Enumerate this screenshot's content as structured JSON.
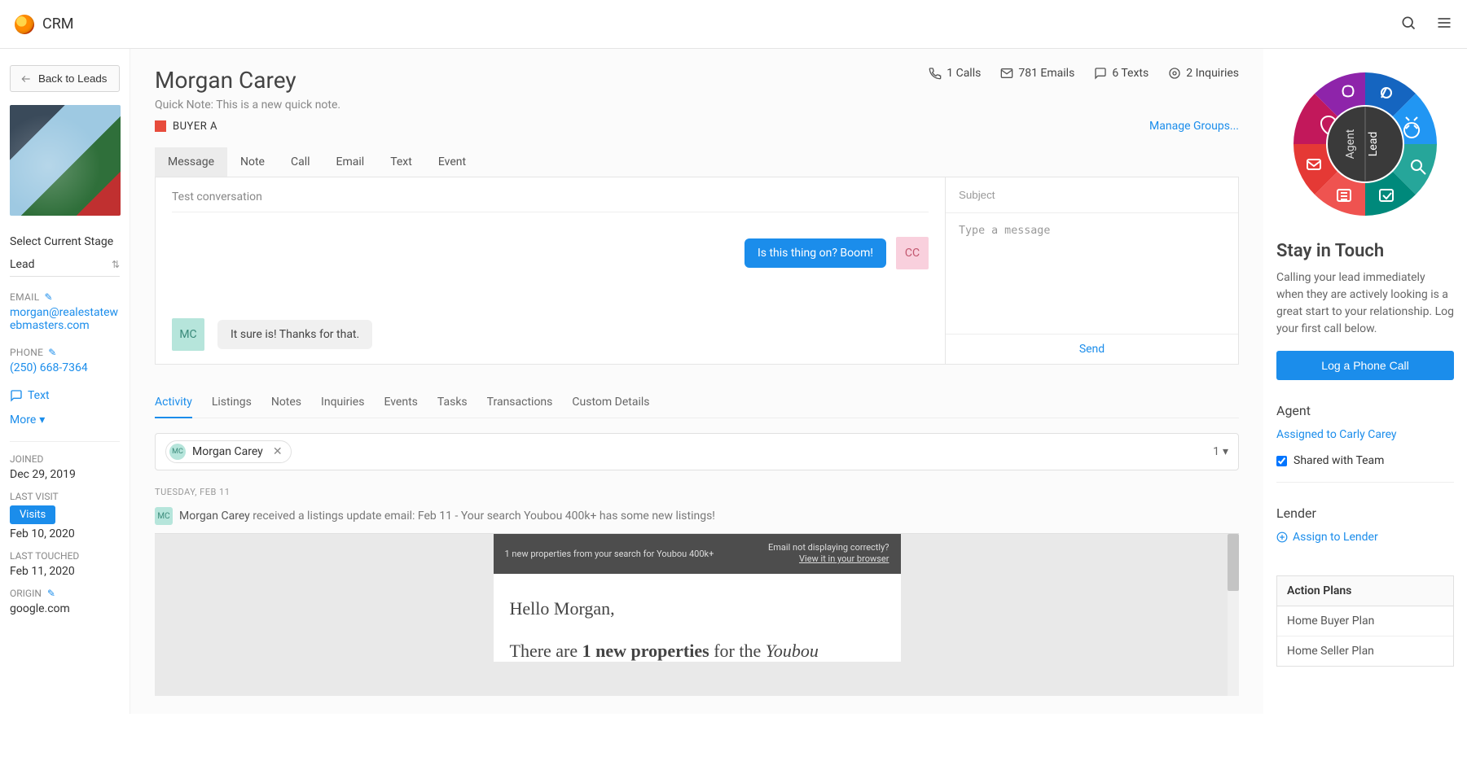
{
  "topbar": {
    "brand": "CRM"
  },
  "sidebar_left": {
    "back_label": "Back to Leads",
    "stage_label": "Select Current Stage",
    "stage_value": "Lead",
    "email_label": "EMAIL",
    "email_value": "morgan@realestatewebmasters.com",
    "phone_label": "PHONE",
    "phone_value": "(250) 668-7364",
    "text_label": "Text",
    "more_label": "More",
    "joined_label": "JOINED",
    "joined_value": "Dec 29, 2019",
    "lastvisit_label": "LAST VISIT",
    "visits_btn": "Visits",
    "lastvisit_value": "Feb 10, 2020",
    "lasttouched_label": "LAST TOUCHED",
    "lasttouched_value": "Feb 11, 2020",
    "origin_label": "ORIGIN",
    "origin_value": "google.com"
  },
  "header": {
    "lead_name": "Morgan Carey",
    "quick_note": "Quick Note: This is a new quick note.",
    "tag_label": "BUYER A",
    "manage_groups": "Manage Groups...",
    "stats": {
      "calls": "1 Calls",
      "emails": "781 Emails",
      "texts": "6 Texts",
      "inquiries": "2 Inquiries"
    }
  },
  "compose": {
    "tabs": [
      "Message",
      "Note",
      "Call",
      "Email",
      "Text",
      "Event"
    ],
    "conv_title": "Test conversation",
    "bubble_out": "Is this thing on? Boom!",
    "avatar_out": "CC",
    "avatar_in": "MC",
    "bubble_in": "It sure is! Thanks for that.",
    "subject_placeholder": "Subject",
    "message_placeholder": "Type a message",
    "send_label": "Send"
  },
  "activity_tabs": [
    "Activity",
    "Listings",
    "Notes",
    "Inquiries",
    "Events",
    "Tasks",
    "Transactions",
    "Custom Details"
  ],
  "filter": {
    "chip_name": "Morgan Carey",
    "chip_initials": "MC",
    "count": "1"
  },
  "timeline": {
    "day": "Tuesday, Feb 11",
    "item_initials": "MC",
    "item_name": "Morgan Carey",
    "item_text": " received a listings update email: Feb 11 - Your search Youbou 400k+ has some new listings!",
    "email": {
      "headline": "1 new properties from your search for Youbou 400k+",
      "sm1": "Email not displaying correctly?",
      "sm2": "View it in your browser",
      "greeting": "Hello Morgan,",
      "body_prefix": "There are ",
      "body_bold": "1 new properties",
      "body_mid": " for the ",
      "body_italic": "Youbou"
    }
  },
  "right": {
    "wheel": {
      "label1": "Agent",
      "label2": "Lead"
    },
    "touch_h": "Stay in Touch",
    "touch_p": "Calling your lead immediately when they are actively looking is a great start to your relationship. Log your first call below.",
    "cta": "Log a Phone Call",
    "agent_h": "Agent",
    "agent_link": "Assigned to Carly Carey",
    "shared_label": "Shared with Team",
    "lender_h": "Lender",
    "lender_link": "Assign to Lender",
    "plans_h": "Action Plans",
    "plans": [
      "Home Buyer Plan",
      "Home Seller Plan"
    ]
  }
}
